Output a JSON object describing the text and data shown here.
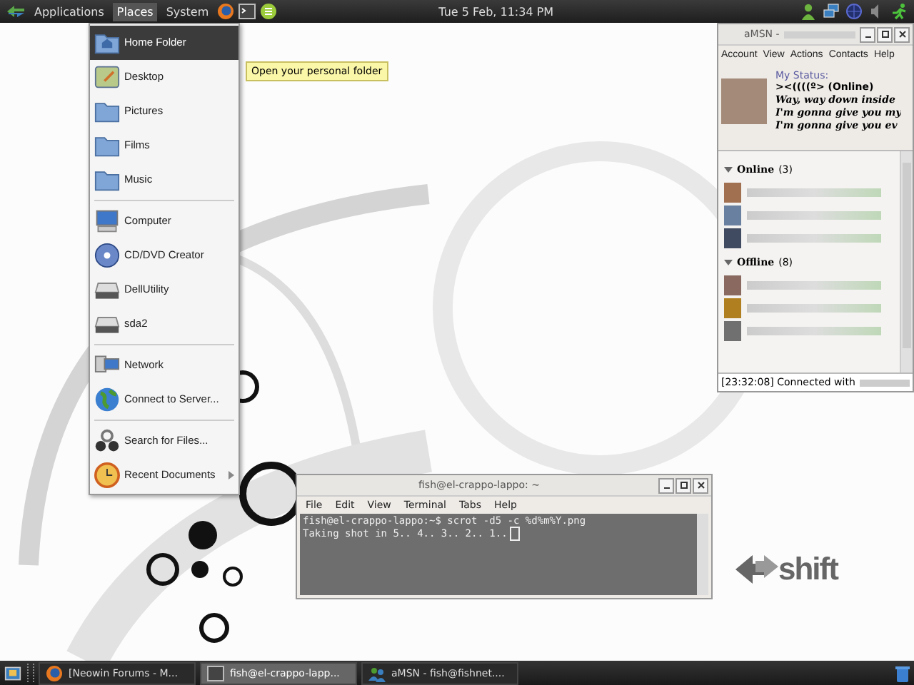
{
  "top_panel": {
    "menus": [
      {
        "label": "Applications",
        "selected": false
      },
      {
        "label": "Places",
        "selected": true
      },
      {
        "label": "System",
        "selected": false
      }
    ],
    "clock": "Tue  5 Feb, 11:34 PM"
  },
  "places_menu": {
    "sections": [
      [
        {
          "label": "Home Folder",
          "kind": "home",
          "selected": true,
          "submenu": false
        },
        {
          "label": "Desktop",
          "kind": "desktop",
          "selected": false,
          "submenu": false
        },
        {
          "label": "Pictures",
          "kind": "folder",
          "selected": false,
          "submenu": false
        },
        {
          "label": "Films",
          "kind": "folder",
          "selected": false,
          "submenu": false
        },
        {
          "label": "Music",
          "kind": "folder",
          "selected": false,
          "submenu": false
        }
      ],
      [
        {
          "label": "Computer",
          "kind": "computer",
          "selected": false,
          "submenu": false
        },
        {
          "label": "CD/DVD Creator",
          "kind": "disc",
          "selected": false,
          "submenu": false
        },
        {
          "label": "DellUtility",
          "kind": "drive",
          "selected": false,
          "submenu": false
        },
        {
          "label": "sda2",
          "kind": "drive",
          "selected": false,
          "submenu": false
        }
      ],
      [
        {
          "label": "Network",
          "kind": "network",
          "selected": false,
          "submenu": false
        },
        {
          "label": "Connect to Server...",
          "kind": "globe",
          "selected": false,
          "submenu": false
        }
      ],
      [
        {
          "label": "Search for Files...",
          "kind": "search",
          "selected": false,
          "submenu": false
        },
        {
          "label": "Recent Documents",
          "kind": "clock",
          "selected": false,
          "submenu": true
        }
      ]
    ]
  },
  "tooltip": "Open your personal folder",
  "amsn": {
    "title": "aMSN -",
    "menu": [
      "Account",
      "View",
      "Actions",
      "Contacts",
      "Help"
    ],
    "status_label": "My Status:",
    "nick": "><((((º> (Online)",
    "messages": [
      "Way, way down inside",
      "I'm gonna give you my",
      "I'm gonna give you ev"
    ],
    "groups": [
      {
        "name": "Online",
        "count": "(3)",
        "expanded": true
      },
      {
        "name": "Offline",
        "count": "(8)",
        "expanded": true
      }
    ],
    "status_bar": "[23:32:08] Connected with"
  },
  "terminal": {
    "title": "fish@el-crappo-lappo: ~",
    "menu": [
      "File",
      "Edit",
      "View",
      "Terminal",
      "Tabs",
      "Help"
    ],
    "lines": [
      "fish@el-crappo-lappo:~$ scrot -d5 -c %d%m%Y.png",
      "Taking shot in 5.. 4.. 3.. 2.. 1.."
    ]
  },
  "logo": "shift",
  "taskbar": {
    "tasks": [
      {
        "label": "[Neowin Forums - M...",
        "kind": "firefox",
        "selected": false
      },
      {
        "label": "fish@el-crappo-lapp...",
        "kind": "terminal",
        "selected": true
      },
      {
        "label": "aMSN - fish@fishnet....",
        "kind": "people",
        "selected": false
      }
    ]
  }
}
